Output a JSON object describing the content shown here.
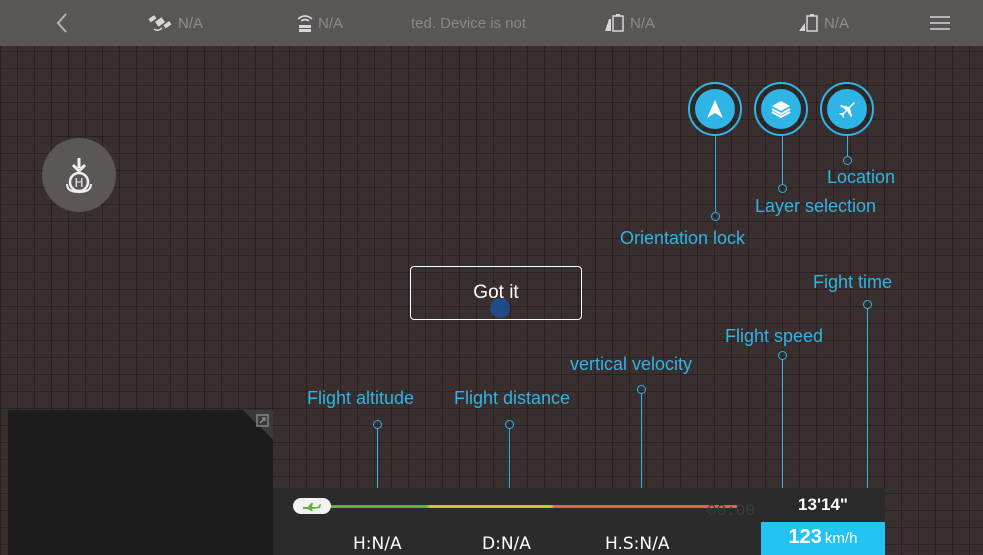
{
  "status_bar": {
    "satellite": "N/A",
    "signal": "N/A",
    "warning": "ted.   Device is not",
    "battery_1": "N/A",
    "battery_2": "N/A"
  },
  "guides": {
    "orientation_lock": "Orientation lock",
    "layer_selection": "Layer selection",
    "location": "Location",
    "flight_time": "Fight time",
    "flight_speed": "Flight speed",
    "vertical_velocity": "vertical velocity",
    "flight_altitude": "Flight altitude",
    "flight_distance": "Flight distance"
  },
  "dialog": {
    "got_it": "Got it"
  },
  "telemetry": {
    "height": "H:N/A",
    "distance": "D:N/A",
    "horizontal_speed": "H.S:N/A",
    "ghost_time": "00:00"
  },
  "flight": {
    "time": "13'14\"",
    "speed": "123",
    "speed_unit": "km/h"
  },
  "colors": {
    "accent": "#2fb4e6",
    "speed_box": "#23c3f3"
  }
}
